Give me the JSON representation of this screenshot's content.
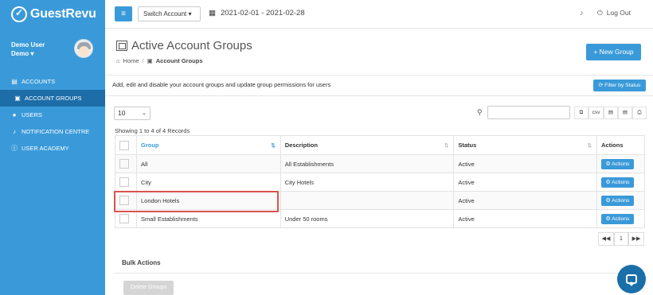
{
  "app": {
    "brand": "GuestRevu"
  },
  "user": {
    "name": "Demo User",
    "account": "Demo ▾"
  },
  "sidebar": {
    "items": [
      {
        "label": "ACCOUNTS",
        "icon": "list-icon"
      },
      {
        "label": "ACCOUNT GROUPS",
        "icon": "group-icon",
        "active": true
      },
      {
        "label": "USERS",
        "icon": "user-icon"
      },
      {
        "label": "NOTIFICATION CENTRE",
        "icon": "bell-icon"
      },
      {
        "label": "USER ACADEMY",
        "icon": "info-icon"
      }
    ]
  },
  "topbar": {
    "menu_icon": "≡",
    "switch_account": "Switch Account ▾",
    "date_range": "2021-02-01 - 2021-02-28",
    "logout": "Log Out"
  },
  "page": {
    "title": "Active Account Groups",
    "breadcrumb_home": "Home",
    "breadcrumb_sep": "/",
    "breadcrumb_current": "Account Groups",
    "new_group": "+ New Group",
    "intro": "Add, edit and disable your account groups and update group permissions for users",
    "filter_status": "⟳ Filter by Status"
  },
  "table_controls": {
    "page_size": "10",
    "search_placeholder": "",
    "tools": [
      "⧉",
      "csv",
      "▤",
      "▤",
      "⎙"
    ],
    "records_info": "Showing 1 to 4 of 4 Records"
  },
  "table": {
    "headers": [
      "Group",
      "Description",
      "Status",
      "Actions"
    ],
    "rows": [
      {
        "group": "All",
        "description": "All Establishments",
        "status": "Active",
        "action": "⚙ Actions"
      },
      {
        "group": "City",
        "description": "City Hotels",
        "status": "Active",
        "action": "⚙ Actions"
      },
      {
        "group": "London Hotels",
        "description": "",
        "status": "Active",
        "action": "⚙ Actions"
      },
      {
        "group": "Small Establishments",
        "description": "Under 50 rooms",
        "status": "Active",
        "action": "⚙ Actions"
      }
    ]
  },
  "pager": {
    "prev": "◀◀",
    "page": "1",
    "next": "▶▶"
  },
  "bulk": {
    "title": "Bulk Actions",
    "delete": "Delete Groups"
  },
  "colors": {
    "accent": "#3a9ad9",
    "active_nav": "#1c6da8",
    "highlight": "#d9534f"
  }
}
